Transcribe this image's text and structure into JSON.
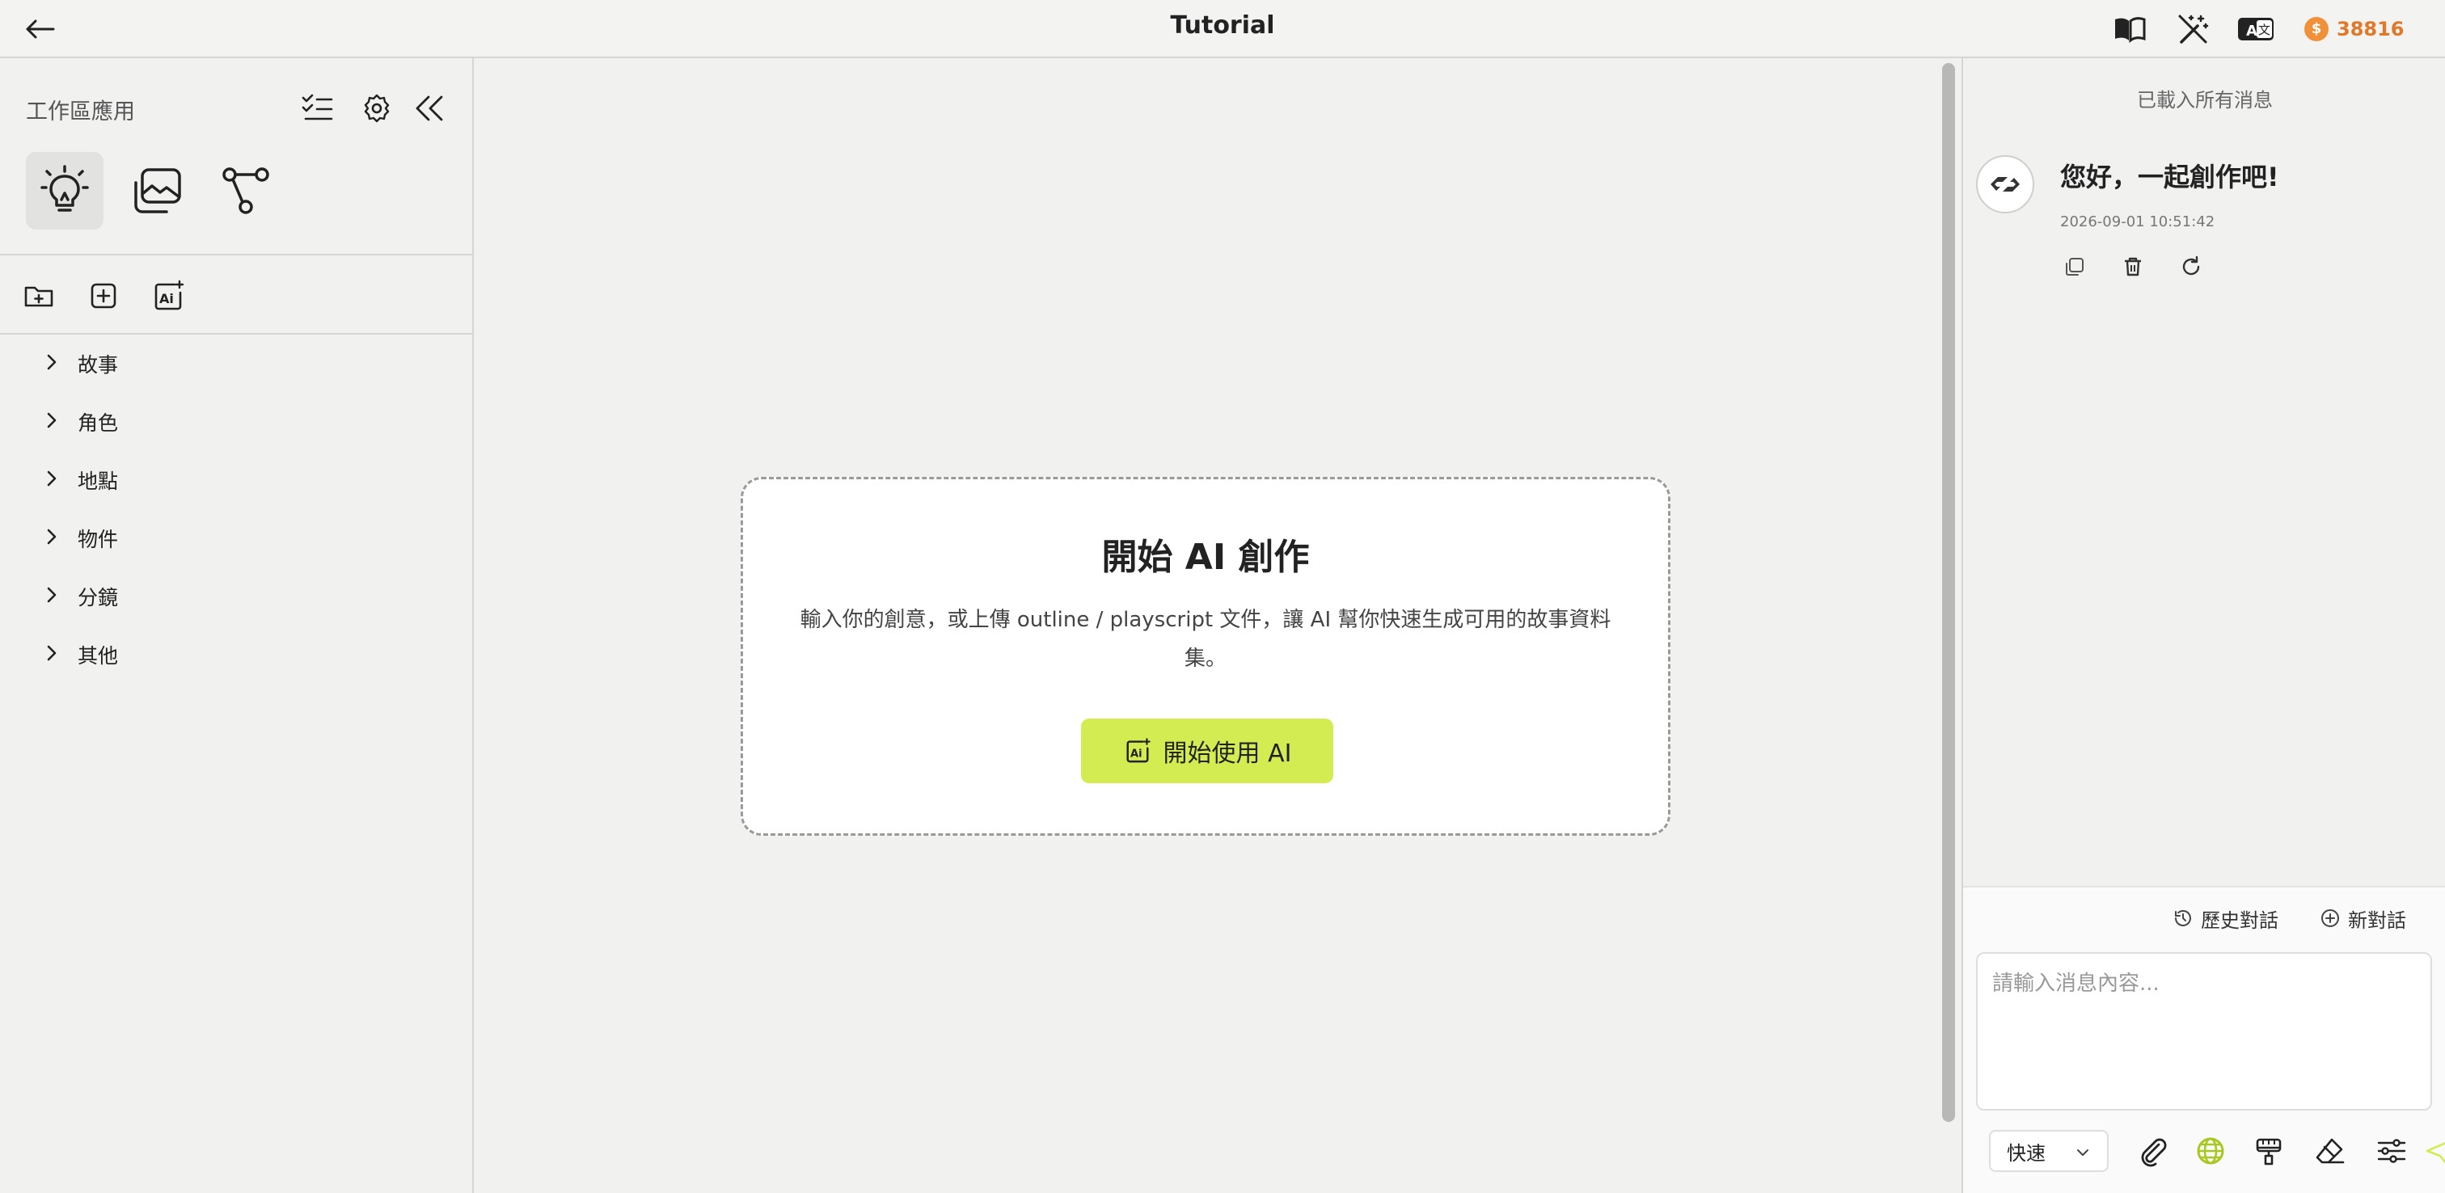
{
  "header": {
    "title": "Tutorial",
    "credits": "38816",
    "coin_symbol": "$"
  },
  "sidebar": {
    "title": "工作區應用",
    "tree_items": [
      {
        "label": "故事"
      },
      {
        "label": "角色"
      },
      {
        "label": "地點"
      },
      {
        "label": "物件"
      },
      {
        "label": "分鏡"
      },
      {
        "label": "其他"
      }
    ]
  },
  "main": {
    "card_title": "開始 AI 創作",
    "card_description": "輸入你的創意，或上傳 outline / playscript 文件，讓 AI 幫你快速生成可用的故事資料集。",
    "start_button": "開始使用 AI"
  },
  "chat": {
    "loaded_note": "已載入所有消息",
    "greeting": "您好，一起創作吧!",
    "timestamp": "2026-09-01 10:51:42",
    "history_label": "歷史對話",
    "new_chat_label": "新對話",
    "input_placeholder": "請輸入消息內容...",
    "speed_value": "快速"
  },
  "colors": {
    "accent": "#d2ec52",
    "credits": "#e0782a",
    "globe_active": "#a8c820"
  }
}
